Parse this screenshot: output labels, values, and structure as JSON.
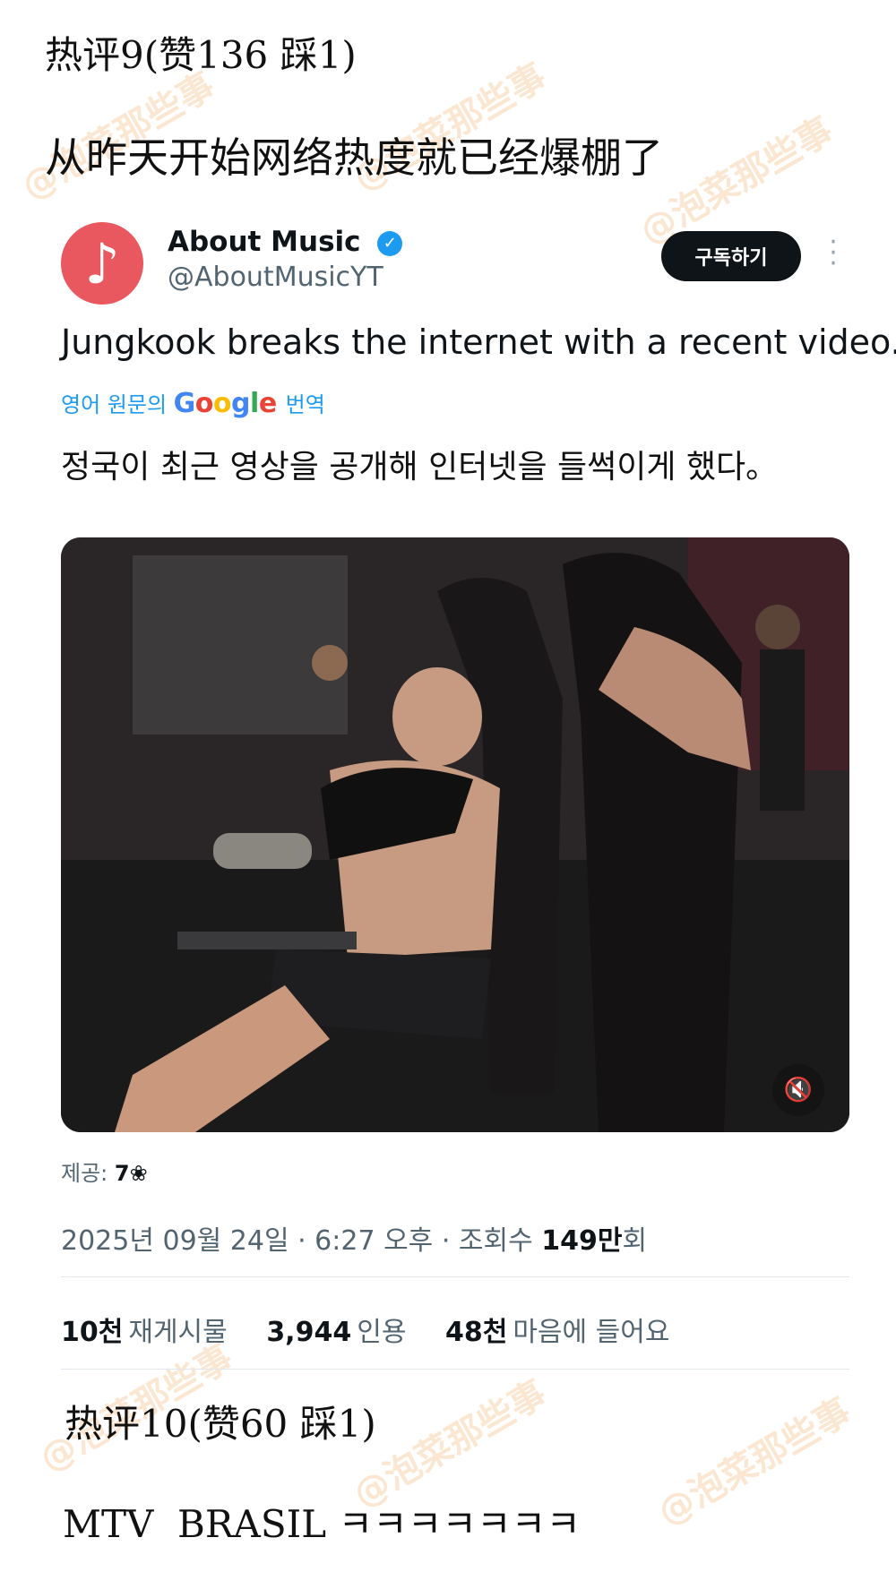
{
  "comment9": {
    "title": "热评9(赞136 踩1)",
    "body": "从昨天开始网络热度就已经爆棚了"
  },
  "tweet": {
    "account_name": "About Music",
    "handle": "@AboutMusicYT",
    "follow_label": "구독하기",
    "text": "Jungkook breaks the internet with a recent video.",
    "translate_prefix": "영어 원문의",
    "translate_brand": "Google",
    "translate_suffix": "번역",
    "translated_text": "정국이 최근 영상을 공개해 인터넷을 들썩이게 했다。",
    "credit_label": "제공:",
    "credit_value": "7❀",
    "timestamp": "2025년 09월 24일 · 6:27 오후 · 조회수",
    "views_value": "149만",
    "views_suffix": "회",
    "stats": {
      "reposts_value": "10천",
      "reposts_label": "재게시물",
      "quotes_value": "3,944",
      "quotes_label": "인용",
      "likes_value": "48천",
      "likes_label": "마음에 들어요"
    }
  },
  "comment10": {
    "title": "热评10(赞60 踩1)",
    "body": "MTV  BRASIL ㅋㅋㅋㅋㅋㅋㅋ"
  },
  "watermark_text": "@泡菜那些事",
  "icons": {
    "avatar": "music-note-icon",
    "verified": "verified-badge-icon",
    "more": "more-options-icon",
    "mute": "mute-icon"
  },
  "colors": {
    "avatar_bg": "#e9575f",
    "verified": "#1d9bf0",
    "button_bg": "#0f1419",
    "muted_text": "#536471"
  }
}
